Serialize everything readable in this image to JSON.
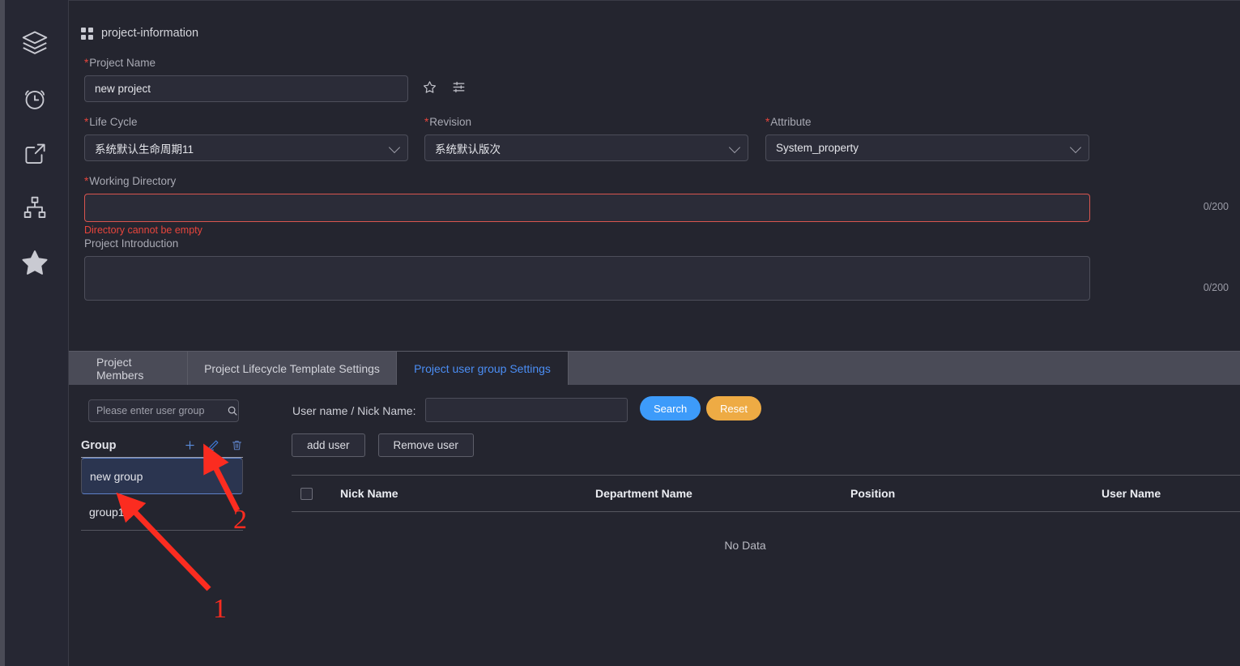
{
  "sidebar": {
    "items": [
      {
        "name": "layers-icon",
        "label": "Layers"
      },
      {
        "name": "alarm-clock-icon",
        "label": "Alarm"
      },
      {
        "name": "share-export-icon",
        "label": "Share"
      },
      {
        "name": "sitemap-icon",
        "label": "Hierarchy"
      },
      {
        "name": "star-filled-icon",
        "label": "Favorites"
      }
    ]
  },
  "header": {
    "title": "project-information",
    "icon": "grid-icon"
  },
  "form": {
    "project_name": {
      "label": "Project Name",
      "required": true,
      "value": "new project"
    },
    "favorite_icon": "star-outline-icon",
    "settings_icon": "sliders-icon",
    "life_cycle": {
      "label": "Life Cycle",
      "required": true,
      "value": "系统默认生命周期11"
    },
    "revision": {
      "label": "Revision",
      "required": true,
      "value": "系统默认版次"
    },
    "attribute": {
      "label": "Attribute",
      "required": true,
      "value": "System_property"
    },
    "working_directory": {
      "label": "Working Directory",
      "required": true,
      "value": "",
      "counter": "0/200",
      "error": "Directory cannot be empty"
    },
    "project_introduction": {
      "label": "Project Introduction",
      "required": false,
      "value": "",
      "counter": "0/200"
    }
  },
  "tabs": [
    {
      "label": "Project Members",
      "active": false
    },
    {
      "label": "Project Lifecycle Template Settings",
      "active": false
    },
    {
      "label": "Project user group Settings",
      "active": true
    }
  ],
  "toolbar": {
    "group_search_placeholder": "Please enter user group",
    "group_search_value": "",
    "search_icon": "search-icon",
    "user_label": "User name / Nick Name:",
    "user_value": "",
    "search_button": "Search",
    "reset_button": "Reset",
    "search_color": "#3d9bfa",
    "reset_color": "#eeab44"
  },
  "group_panel": {
    "title": "Group",
    "actions": [
      {
        "name": "add-group-icon",
        "glyph": "plus"
      },
      {
        "name": "edit-group-icon",
        "glyph": "pencil"
      },
      {
        "name": "delete-group-icon",
        "glyph": "trash"
      }
    ],
    "items": [
      {
        "label": "new group",
        "selected": true
      },
      {
        "label": "group1",
        "selected": false
      }
    ]
  },
  "user_table": {
    "buttons": [
      {
        "label": "add user",
        "name": "add-user-button"
      },
      {
        "label": "Remove user",
        "name": "remove-user-button"
      }
    ],
    "columns": [
      "Nick Name",
      "Department Name",
      "Position",
      "User Name"
    ],
    "rows": [],
    "empty_text": "No Data"
  },
  "annotations": [
    {
      "label": "1",
      "target": "new group list item"
    },
    {
      "label": "2",
      "target": "edit group pencil icon"
    }
  ]
}
